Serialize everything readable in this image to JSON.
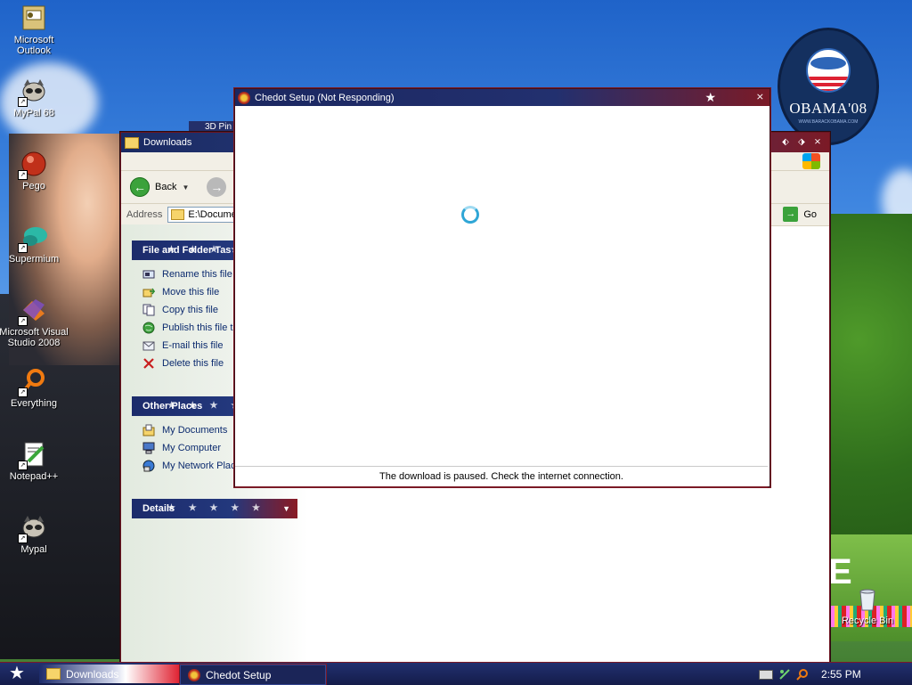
{
  "desktop": {
    "icons": [
      {
        "label_line1": "Microsoft",
        "label_line2": "Outlook",
        "icon": "outlook-icon"
      },
      {
        "label_line1": "MyPal 68",
        "label_line2": "",
        "icon": "mypal-raccoon-icon"
      },
      {
        "label_line1": "Pego",
        "label_line2": "",
        "icon": "pego-icon"
      },
      {
        "label_line1": "Supermium",
        "label_line2": "",
        "icon": "supermium-icon"
      },
      {
        "label_line1": "Microsoft Visual",
        "label_line2": "Studio 2008",
        "icon": "visual-studio-icon"
      },
      {
        "label_line1": "Everything",
        "label_line2": "",
        "icon": "everything-icon"
      },
      {
        "label_line1": "Notepad++",
        "label_line2": "",
        "icon": "notepadpp-icon"
      },
      {
        "label_line1": "Mypal",
        "label_line2": "",
        "icon": "mypal-raccoon-icon"
      }
    ],
    "recycle_bin": "Recycle Bin",
    "obama_badge": {
      "text": "OBAMA'08",
      "sub": "WWW.BARACKOBAMA.COM"
    },
    "background_window_title": "3D Pin"
  },
  "explorer": {
    "title": "Downloads",
    "back_label": "Back",
    "address_label": "Address",
    "address_value": "E:\\Documen",
    "go_label": "Go",
    "file_tasks_title": "File and Folder Tas",
    "file_tasks": [
      {
        "label": "Rename this file",
        "icon": "rename-icon"
      },
      {
        "label": "Move this file",
        "icon": "move-icon"
      },
      {
        "label": "Copy this file",
        "icon": "copy-icon"
      },
      {
        "label": "Publish this file to",
        "icon": "publish-web-icon"
      },
      {
        "label": "E-mail this file",
        "icon": "email-icon"
      },
      {
        "label": "Delete this file",
        "icon": "delete-x-icon"
      }
    ],
    "other_places_title": "Other Places",
    "other_places": [
      {
        "label": "My Documents",
        "icon": "my-documents-icon"
      },
      {
        "label": "My Computer",
        "icon": "my-computer-icon"
      },
      {
        "label": "My Network Plac",
        "icon": "network-places-icon"
      }
    ],
    "details_title": "Details"
  },
  "chedot": {
    "title": "Chedot Setup (Not Responding)",
    "status": "The download is paused. Check the internet connection."
  },
  "taskbar": {
    "buttons": [
      {
        "label": "Downloads"
      },
      {
        "label": "Chedot Setup"
      }
    ],
    "clock": "2:55 PM"
  },
  "colors": {
    "title_blue": "#1b2760",
    "title_red": "#7b1a26",
    "link_blue": "#0b2a6e",
    "spinner": "#2fa6d6"
  }
}
